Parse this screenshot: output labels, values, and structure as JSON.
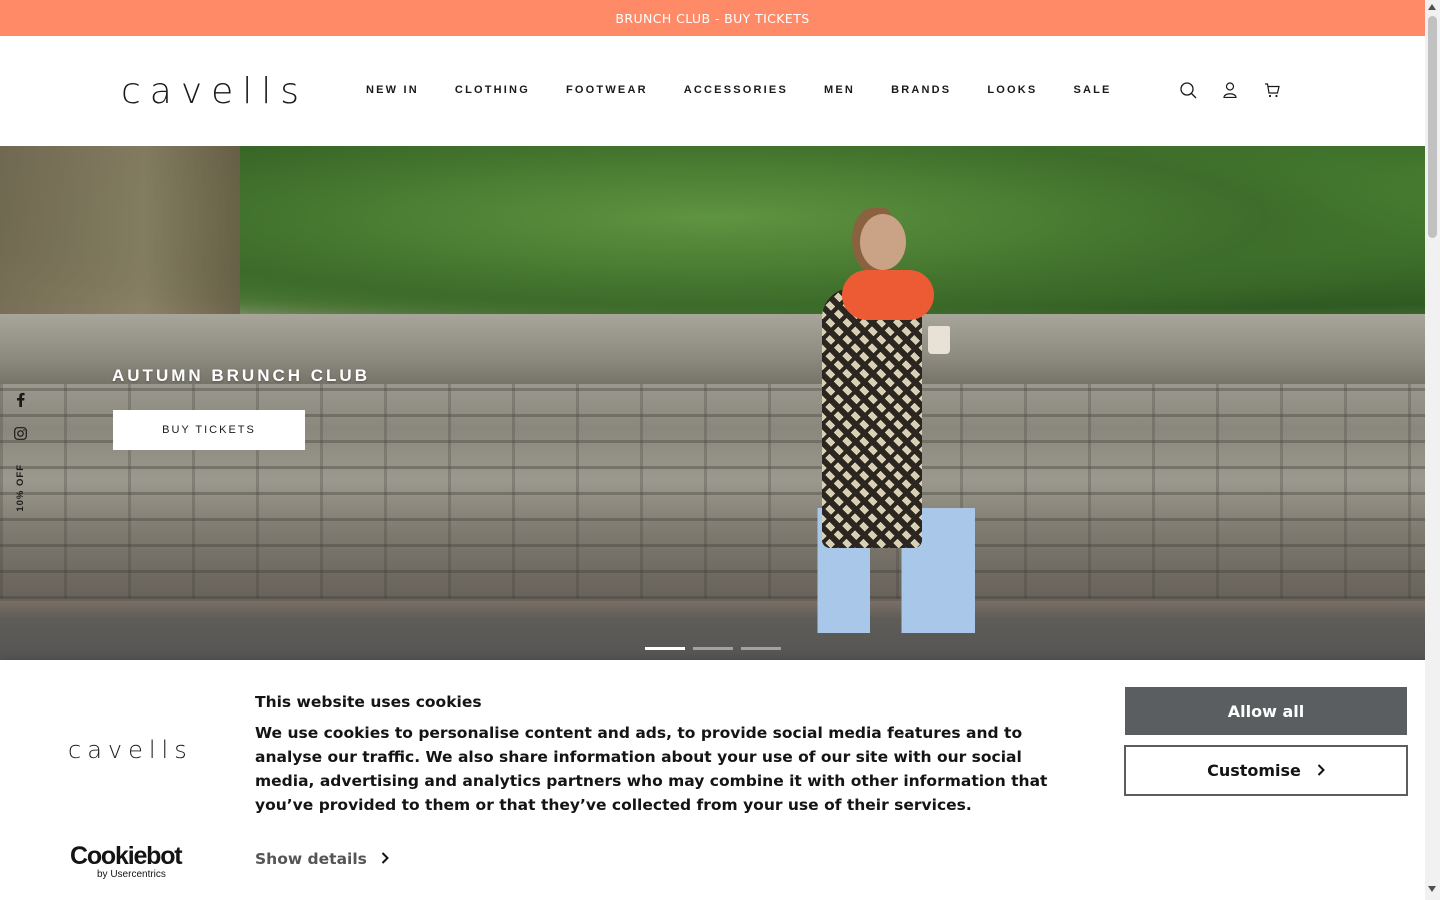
{
  "announcement": {
    "text": "BRUNCH CLUB - BUY TICKETS"
  },
  "header": {
    "logo": "cavells",
    "nav": [
      "NEW IN",
      "CLOTHING",
      "FOOTWEAR",
      "ACCESSORIES",
      "MEN",
      "BRANDS",
      "LOOKS",
      "SALE"
    ],
    "icons": [
      "search-icon",
      "account-icon",
      "cart-icon"
    ]
  },
  "hero": {
    "title": "AUTUMN BRUNCH CLUB",
    "button": "BUY TICKETS",
    "slides": 3,
    "active_slide": 1
  },
  "side": {
    "icons": [
      "facebook-icon",
      "instagram-icon"
    ],
    "promo": "10% OFF"
  },
  "cookie": {
    "logo": "cavells",
    "title": "This website uses cookies",
    "body": "We use cookies to personalise content and ads, to provide social media features and to analyse our traffic. We also share information about your use of our site with our social media, advertising and analytics partners who may combine it with other information that you’ve provided to them or that they’ve collected from your use of their services.",
    "show_details": "Show details",
    "allow_all": "Allow all",
    "customise": "Customise",
    "brand": "Cookiebot",
    "brand_sub": "by Usercentrics"
  },
  "colors": {
    "announcement": "#fe8a67",
    "allow_button": "#5a5e60"
  }
}
